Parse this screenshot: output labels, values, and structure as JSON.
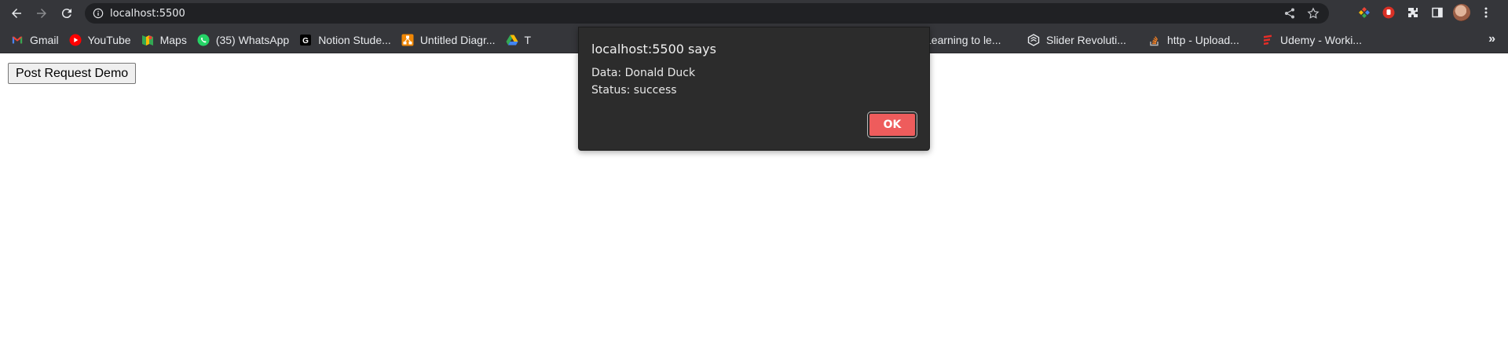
{
  "browser": {
    "url": "localhost:5500",
    "colors": {
      "frame": "#35363a",
      "omnibox": "#202124",
      "text": "#e8eaed"
    }
  },
  "bookmarks": [
    {
      "label": "Gmail",
      "icon": "gmail-icon"
    },
    {
      "label": "YouTube",
      "icon": "youtube-icon"
    },
    {
      "label": "Maps",
      "icon": "maps-icon"
    },
    {
      "label": "(35) WhatsApp",
      "icon": "whatsapp-icon"
    },
    {
      "label": "Notion Stude...",
      "icon": "notion-icon"
    },
    {
      "label": "Untitled Diagr...",
      "icon": "drawio-icon"
    },
    {
      "label": "T",
      "icon": "google-drive-icon"
    },
    {
      "label": "Learning to le...",
      "icon": "bookmark-icon"
    },
    {
      "label": "Slider Revoluti...",
      "icon": "slider-revolution-icon"
    },
    {
      "label": "http - Upload...",
      "icon": "stackoverflow-icon"
    },
    {
      "label": "Udemy - Worki...",
      "icon": "udemy-icon"
    }
  ],
  "page": {
    "button_label": "Post Request Demo"
  },
  "dialog": {
    "title": "localhost:5500 says",
    "line1": "Data: Donald Duck",
    "line2": "Status: success",
    "ok_label": "OK",
    "accent": "#ee5c5c"
  }
}
